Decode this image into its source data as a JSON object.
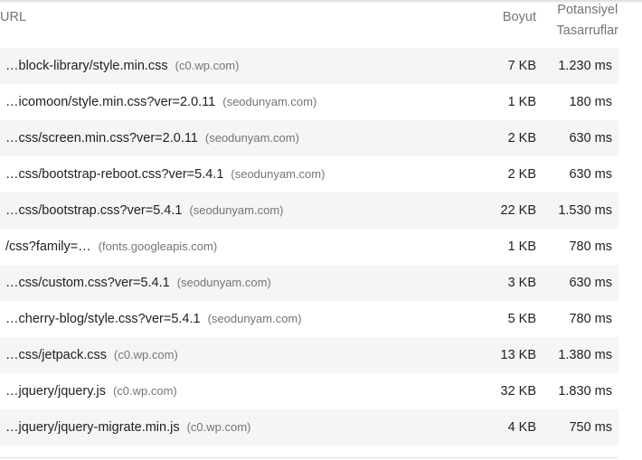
{
  "header": {
    "url": "URL",
    "size": "Boyut",
    "savings_line1": "Potansiyel",
    "savings_line2": "Tasarruflar"
  },
  "rows": [
    {
      "url": "…block-library/style.min.css",
      "origin": "(c0.wp.com)",
      "size": "7 KB",
      "savings": "1.230 ms"
    },
    {
      "url": "…icomoon/style.min.css?ver=2.0.11",
      "origin": "(seodunyam.com)",
      "size": "1 KB",
      "savings": "180 ms"
    },
    {
      "url": "…css/screen.min.css?ver=2.0.11",
      "origin": "(seodunyam.com)",
      "size": "2 KB",
      "savings": "630 ms"
    },
    {
      "url": "…css/bootstrap-reboot.css?ver=5.4.1",
      "origin": "(seodunyam.com)",
      "size": "2 KB",
      "savings": "630 ms"
    },
    {
      "url": "…css/bootstrap.css?ver=5.4.1",
      "origin": "(seodunyam.com)",
      "size": "22 KB",
      "savings": "1.530 ms"
    },
    {
      "url": "/css?family=…",
      "origin": "(fonts.googleapis.com)",
      "size": "1 KB",
      "savings": "780 ms"
    },
    {
      "url": "…css/custom.css?ver=5.4.1",
      "origin": "(seodunyam.com)",
      "size": "3 KB",
      "savings": "630 ms"
    },
    {
      "url": "…cherry-blog/style.css?ver=5.4.1",
      "origin": "(seodunyam.com)",
      "size": "5 KB",
      "savings": "780 ms"
    },
    {
      "url": "…css/jetpack.css",
      "origin": "(c0.wp.com)",
      "size": "13 KB",
      "savings": "1.380 ms"
    },
    {
      "url": "…jquery/jquery.js",
      "origin": "(c0.wp.com)",
      "size": "32 KB",
      "savings": "1.830 ms"
    },
    {
      "url": "…jquery/jquery-migrate.min.js",
      "origin": "(c0.wp.com)",
      "size": "4 KB",
      "savings": "750 ms"
    }
  ]
}
